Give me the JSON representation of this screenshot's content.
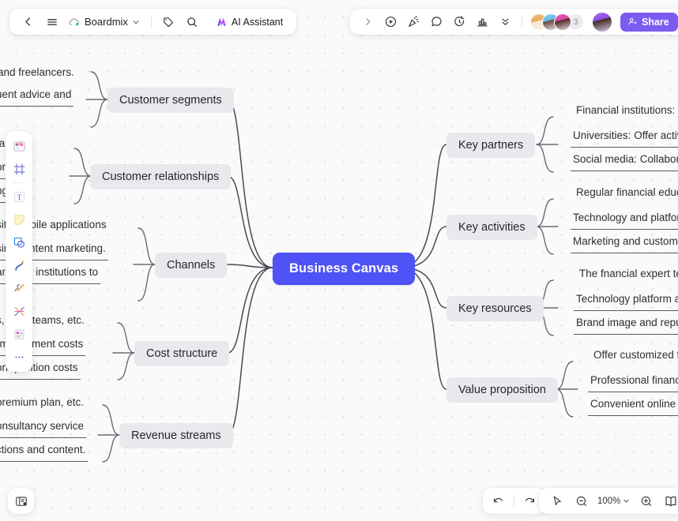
{
  "app": {
    "name": "Boardmix",
    "doc_title": "Boardmix",
    "ai_assistant_label": "AI Assistant",
    "accent_color": "#4f52f5",
    "share_color": "#7b5cf0",
    "branch_node_color": "#e8e8ed",
    "canvas_bg": "#fafafa"
  },
  "topbar_left": {
    "back_icon": "chevron-left-icon",
    "menu_icon": "hamburger-menu-icon",
    "cloud_icon": "cloud-saved-icon",
    "doc_caret_icon": "chevron-down-icon",
    "tag_icon": "tag-icon",
    "search_icon": "search-icon",
    "ai_icon": "ai-sparkle-icon"
  },
  "topbar_right": {
    "expand_icon": "chevron-right-icon",
    "present_icon": "play-circle-icon",
    "celebrate_icon": "confetti-icon",
    "comment_icon": "comment-bubble-icon",
    "timer_icon": "timer-icon",
    "vote_icon": "chart-vote-icon",
    "more_icon": "chevrons-down-icon",
    "collaborator_count": "3",
    "share_label": "Share",
    "share_icon": "share-person-icon",
    "help_icon": "help-circle-icon"
  },
  "tool_palette": {
    "items": [
      {
        "icon": "template-icon"
      },
      {
        "icon": "frame-icon"
      },
      {
        "icon": "text-icon"
      },
      {
        "icon": "sticky-note-icon"
      },
      {
        "icon": "shape-icon"
      },
      {
        "icon": "curve-line-icon"
      },
      {
        "icon": "pen-draw-icon"
      },
      {
        "icon": "connector-icon"
      },
      {
        "icon": "card-icon"
      },
      {
        "icon": "more-tools-icon"
      }
    ]
  },
  "bottom_left": {
    "icon": "panel-layout-icon"
  },
  "bottom_bar": {
    "undo_icon": "undo-icon",
    "redo_icon": "redo-icon",
    "pointer_icon": "cursor-pointer-icon",
    "zoom_out_icon": "zoom-out-icon",
    "zoom_level": "100%",
    "zoom_caret_icon": "chevron-down-icon",
    "zoom_in_icon": "zoom-in-icon",
    "presentation_icon": "presentation-book-icon"
  },
  "mindmap": {
    "root": {
      "label": "Business Canvas"
    },
    "branches_right": [
      {
        "label": "Key partners"
      },
      {
        "label": "Key activities"
      },
      {
        "label": "Key resources"
      },
      {
        "label": "Value proposition"
      }
    ],
    "branches_left": [
      {
        "label": "Customer segments"
      },
      {
        "label": "Customer relationships"
      },
      {
        "label": "Channels"
      },
      {
        "label": "Cost structure"
      },
      {
        "label": "Revenue streams"
      }
    ],
    "leaves_right": [
      {
        "label": "Financial institutions: Co"
      },
      {
        "label": "Universities: Offer activiti"
      },
      {
        "label": "Social media: Collaborate"
      },
      {
        "label": "Regular financial educat"
      },
      {
        "label": "Technology and platform"
      },
      {
        "label": "Marketing and customer"
      },
      {
        "label": "The fnancial expert tea"
      },
      {
        "label": "Technology platform an"
      },
      {
        "label": "Brand image and reputa"
      },
      {
        "label": "Offer customized fi"
      },
      {
        "label": "Professional financ"
      },
      {
        "label": "Convenient online"
      }
    ],
    "leaves_left": [
      {
        "label": "and freelancers."
      },
      {
        "label": "uent advice and"
      },
      {
        "label": "ta          vice"
      },
      {
        "label": "ori        tc."
      },
      {
        "label": "ng        ing."
      },
      {
        "label": "site        mobile applications"
      },
      {
        "label": "sin        l content marketing."
      },
      {
        "label": "an        ncial institutions to"
      },
      {
        "label": "s, t      ical teams, etc."
      },
      {
        "label": "rm      elopment costs"
      },
      {
        "label": "on      quisition costs"
      },
      {
        "label": "premium plan, etc."
      },
      {
        "label": "onsultancy service"
      },
      {
        "label": "ctions and content."
      }
    ]
  }
}
